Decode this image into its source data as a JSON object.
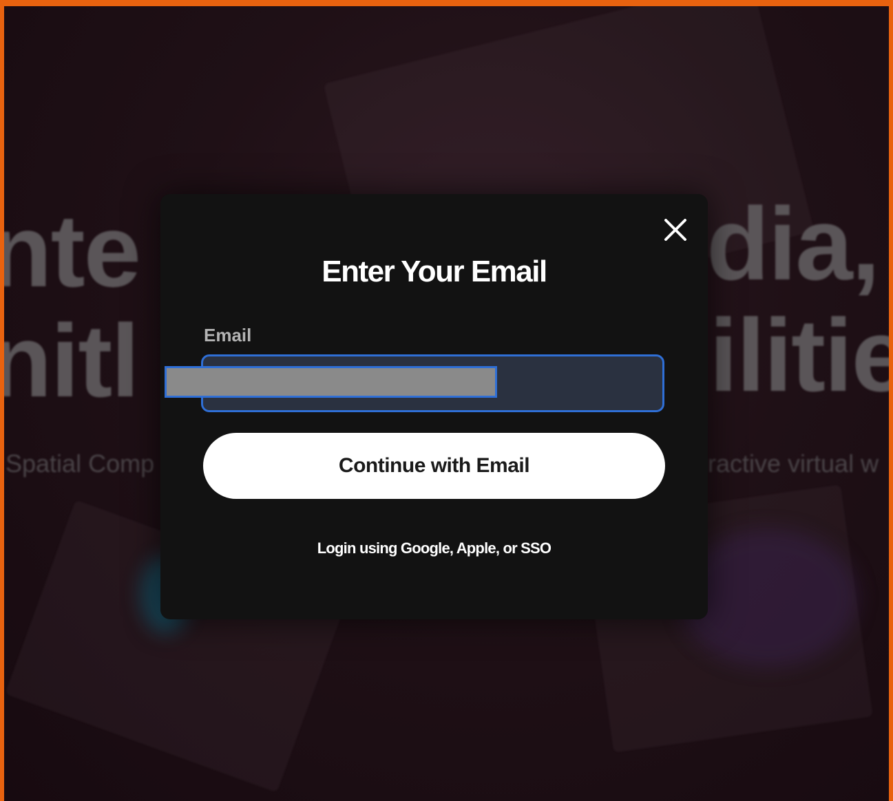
{
  "background": {
    "headline_line1_left": "nte",
    "headline_line1_right": "dia,",
    "headline_line2_left": "nitl",
    "headline_line2_right": "ilitie",
    "subtitle_left": "Spatial Comp",
    "subtitle_right": "ractive virtual w"
  },
  "modal": {
    "title": "Enter Your Email",
    "email_label": "Email",
    "email_value": "",
    "continue_label": "Continue with Email",
    "alt_login_label": "Login using Google, Apple, or SSO",
    "close_icon": "close-icon"
  },
  "colors": {
    "frame_border": "#e8620f",
    "modal_background": "#121212",
    "input_focus_border": "#2f6fd6",
    "primary_button": "#ffffff"
  }
}
